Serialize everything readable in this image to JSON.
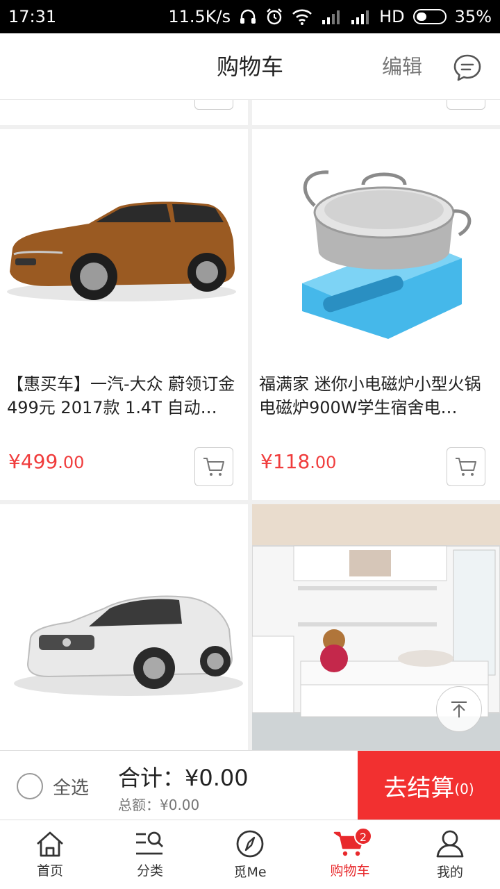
{
  "status_bar": {
    "time": "17:31",
    "speed": "11.5K/s",
    "network": "HD",
    "battery": "35%"
  },
  "header": {
    "title": "购物车",
    "edit": "编辑",
    "message_icon": "chat-bubble-icon"
  },
  "products": [
    {
      "name": "【惠买车】一汽-大众 蔚领订金499元 2017款 1.4T 自动…",
      "price_int": "¥499",
      "price_dec": ".00",
      "image": "car-brown-suv"
    },
    {
      "name": "福满家 迷你小电磁炉小型火锅电磁炉900W学生宿舍电…",
      "price_int": "¥118",
      "price_dec": ".00",
      "image": "induction-cooker-pot"
    },
    {
      "image": "car-white-sedan"
    },
    {
      "image": "wall-bed-furniture"
    }
  ],
  "checkout": {
    "select_all": "全选",
    "total": "合计：¥0.00",
    "subtotal": "总额：¥0.00",
    "pay_label": "去结算",
    "pay_count": "(0)"
  },
  "bottom_nav": {
    "items": [
      {
        "label": "首页",
        "icon": "home-icon"
      },
      {
        "label": "分类",
        "icon": "category-search-icon"
      },
      {
        "label": "觅Me",
        "icon": "compass-icon"
      },
      {
        "label": "购物车",
        "icon": "cart-icon",
        "badge": "2"
      },
      {
        "label": "我的",
        "icon": "user-icon"
      }
    ]
  },
  "colors": {
    "accent": "#f23030",
    "price": "#f03c3c",
    "nav_active": "#e8292c"
  }
}
